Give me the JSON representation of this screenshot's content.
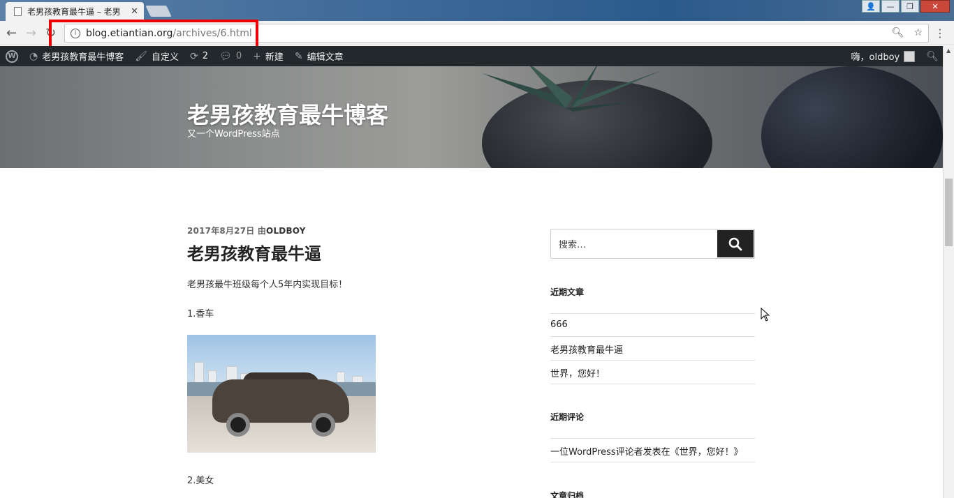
{
  "browser": {
    "tab_title": "老男孩教育最牛逼 – 老男",
    "url_host": "blog.etiantian.org",
    "url_path": "/archives/6.html"
  },
  "adminbar": {
    "site_name": "老男孩教育最牛博客",
    "customize": "自定义",
    "updates_count": "2",
    "comments_count": "0",
    "new_label": "新建",
    "edit_post": "编辑文章",
    "greeting": "嗨，oldboy"
  },
  "header": {
    "site_title": "老男孩教育最牛博客",
    "site_description": "又一个WordPress站点"
  },
  "post": {
    "date": "2017年8月27日",
    "by": "由",
    "author": "OLDBOY",
    "title": "老男孩教育最牛逼",
    "paragraph1": "老男孩最牛班级每个人5年内实现目标！",
    "item1": "1.香车",
    "item2": "2.美女"
  },
  "sidebar": {
    "search_placeholder": "搜索…",
    "recent_posts_title": "近期文章",
    "recent_posts": [
      "666",
      "老男孩教育最牛逼",
      "世界，您好！"
    ],
    "recent_comments_title": "近期评论",
    "recent_comment": "一位WordPress评论者发表在《世界，您好！》",
    "archives_title": "文章归档"
  },
  "colors": {
    "adminbar_bg": "#23282d",
    "highlight_box": "#ee0000",
    "search_button": "#222222"
  }
}
